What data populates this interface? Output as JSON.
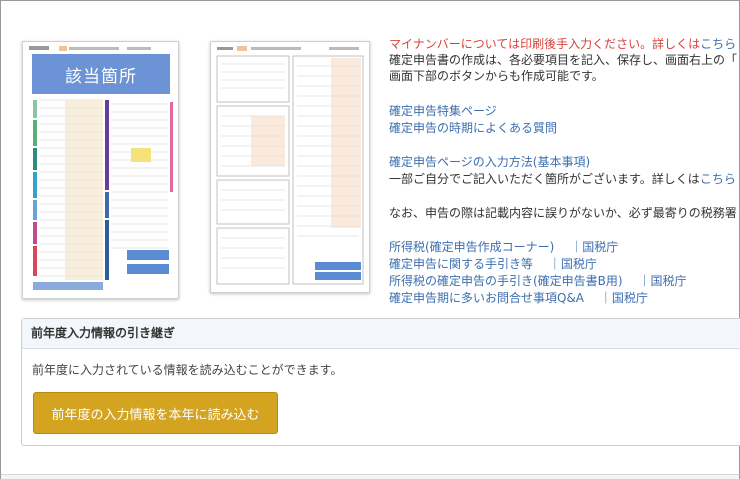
{
  "thumbnails": {
    "form1_highlight_label": "該当箇所"
  },
  "info": {
    "notice_red": "マイナンバーについては印刷後手入力ください。詳しくは",
    "notice_link": "こちら",
    "body_line1": "確定申告書の作成は、各必要項目を記入、保存し、画面右上の「",
    "body_line2": "画面下部のボタンからも作成可能です。",
    "link_special_page": "確定申告特集ページ",
    "link_faq": "確定申告の時期によくある質問",
    "link_input_method": "確定申告ページの入力方法(基本事項)",
    "input_note_text": "一部ご自分でご記入いただく箇所がございます。詳しくは",
    "input_note_link": "こちら",
    "caution_text": "なお、申告の際は記載内容に誤りがないか、必ず最寄りの税務署",
    "separator": "｜",
    "links": [
      {
        "label": "所得税(確定申告作成コーナー)",
        "source": "国税庁"
      },
      {
        "label": "確定申告に関する手引き等",
        "source": "国税庁"
      },
      {
        "label": "所得税の確定申告の手引き(確定申告書B用)",
        "source": "国税庁"
      },
      {
        "label": "確定申告期に多いお問合せ事項Q&A",
        "source": "国税庁"
      }
    ]
  },
  "panel": {
    "title": "前年度入力情報の引き継ぎ",
    "description": "前年度に入力されている情報を読み込むことができます。",
    "button_label": "前年度の入力情報を本年に読み込む"
  },
  "colors": {
    "accent_button": "#d4a320",
    "link": "#3c6fb0",
    "notice": "#d9423a",
    "highlight": "#6b93d6"
  }
}
